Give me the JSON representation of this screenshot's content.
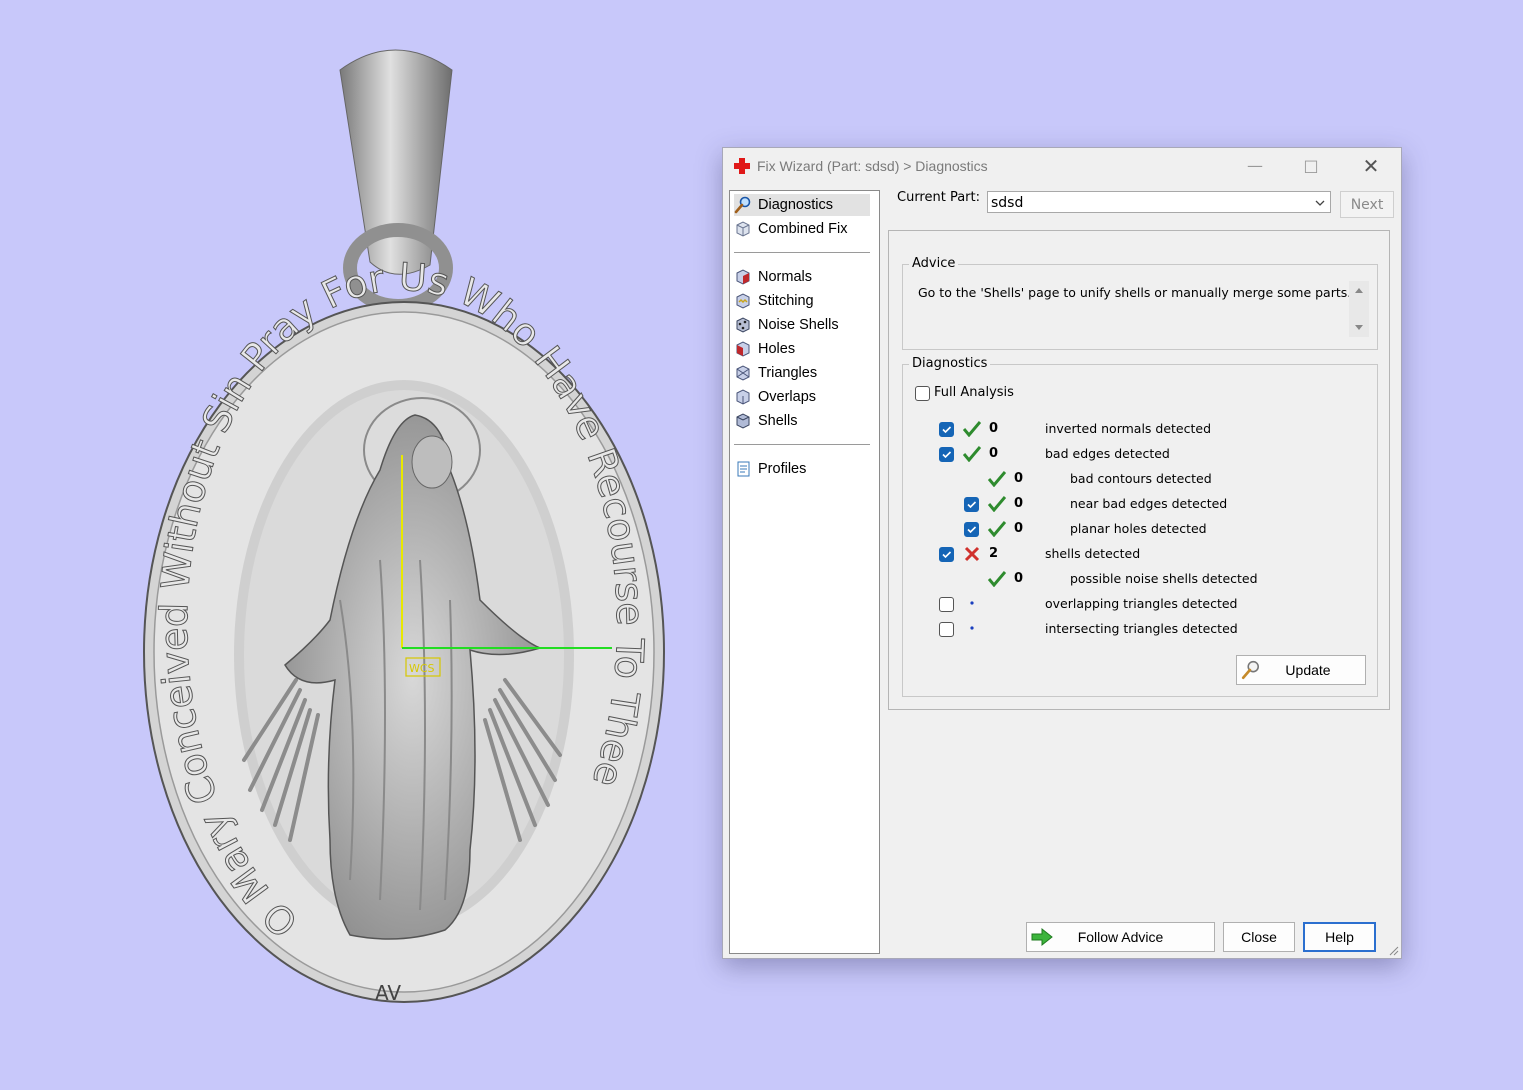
{
  "viewport": {
    "medal_text": "O Mary Conceived Without Sin Pray For Us Who Have Recourse To Thee",
    "axis_label": "WCS",
    "bottom_mark": "AV"
  },
  "dialog": {
    "title": "Fix Wizard (Part: sdsd) > Diagnostics",
    "nav_top": [
      {
        "label": "Diagnostics",
        "icon": "magnifier-icon",
        "selected": true
      },
      {
        "label": "Combined Fix",
        "icon": "cube-icon"
      }
    ],
    "nav_tools": [
      {
        "label": "Normals",
        "icon": "normals-cube-icon"
      },
      {
        "label": "Stitching",
        "icon": "stitching-cube-icon"
      },
      {
        "label": "Noise Shells",
        "icon": "noise-shells-icon"
      },
      {
        "label": "Holes",
        "icon": "holes-cube-icon"
      },
      {
        "label": "Triangles",
        "icon": "triangles-cube-icon"
      },
      {
        "label": "Overlaps",
        "icon": "overlaps-cube-icon"
      },
      {
        "label": "Shells",
        "icon": "shells-cube-icon"
      }
    ],
    "nav_bottom": [
      {
        "label": "Profiles",
        "icon": "document-icon"
      }
    ],
    "current_part_label": "Current Part:",
    "current_part_value": "sdsd",
    "next_label": "Next",
    "advice_title": "Advice",
    "advice_text": "Go to the 'Shells' page to unify shells or manually merge some parts.",
    "diagnostics_title": "Diagnostics",
    "full_analysis_label": "Full Analysis",
    "rows": [
      {
        "checked": true,
        "status": "ok",
        "count": "0",
        "label": "inverted normals detected",
        "indent": 0
      },
      {
        "checked": true,
        "status": "ok",
        "count": "0",
        "label": "bad edges detected",
        "indent": 0
      },
      {
        "checked": null,
        "status": "ok",
        "count": "0",
        "label": "bad contours detected",
        "indent": 1
      },
      {
        "checked": true,
        "status": "ok",
        "count": "0",
        "label": "near bad edges detected",
        "indent": 1
      },
      {
        "checked": true,
        "status": "ok",
        "count": "0",
        "label": "planar holes detected",
        "indent": 1
      },
      {
        "checked": true,
        "status": "error",
        "count": "2",
        "label": "shells detected",
        "indent": 0
      },
      {
        "checked": null,
        "status": "ok",
        "count": "0",
        "label": "possible noise shells detected",
        "indent": 1
      },
      {
        "checked": false,
        "status": "none",
        "count": "",
        "label": "overlapping triangles detected",
        "indent": 0
      },
      {
        "checked": false,
        "status": "none",
        "count": "",
        "label": "intersecting triangles detected",
        "indent": 0
      }
    ],
    "update_label": "Update",
    "follow_advice_label": "Follow Advice",
    "close_label": "Close",
    "help_label": "Help",
    "colors": {
      "check_blue": "#1565b6",
      "ok_green": "#2e8b2e",
      "error_red": "#d0312d",
      "background": "#c8c8fa"
    }
  }
}
